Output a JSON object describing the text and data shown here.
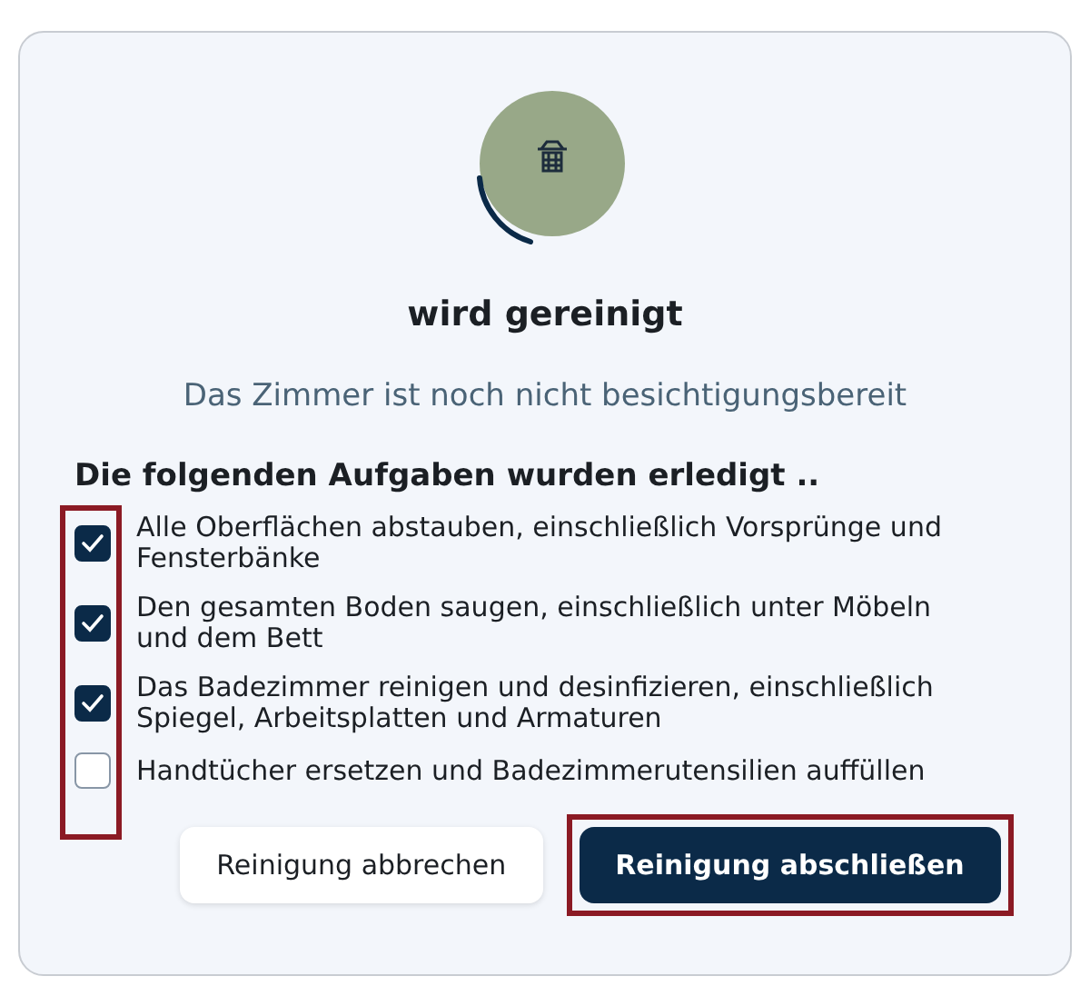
{
  "status": {
    "title": "wird gereinigt",
    "message": "Das Zimmer ist noch nicht besichtigungsbereit"
  },
  "checklist": {
    "heading": "Die folgenden Aufgaben wurden erledigt ..",
    "highlighted": true,
    "items": [
      {
        "label": "Alle Oberflächen abstauben, einschließlich Vorsprünge und Fensterbänke",
        "checked": true
      },
      {
        "label": "Den gesamten Boden saugen, einschließlich unter Möbeln und dem Bett",
        "checked": true
      },
      {
        "label": "Das Badezimmer reinigen und desinfizieren, einschließlich Spiegel, Arbeitsplatten und Armaturen",
        "checked": true
      },
      {
        "label": "Handtücher ersetzen und Badezimmerutensilien auffüllen",
        "checked": false
      }
    ]
  },
  "buttons": [
    {
      "label": "Reinigung abbrechen",
      "kind": "secondary",
      "highlighted": false
    },
    {
      "label": "Reinigung abschließen",
      "kind": "primary",
      "highlighted": true
    }
  ]
}
